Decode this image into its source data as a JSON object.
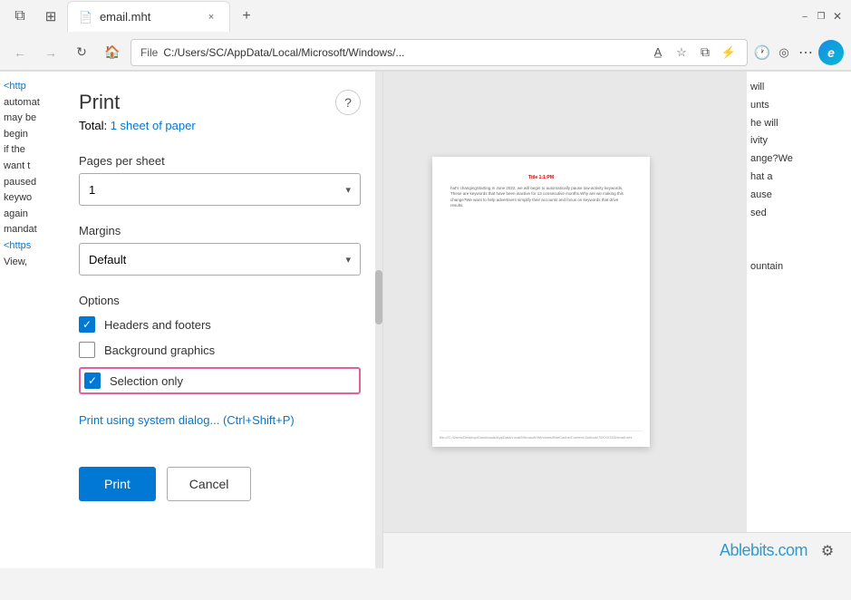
{
  "browser": {
    "title_bar": {
      "tab_label": "email.mht",
      "close_label": "×",
      "new_tab_label": "+",
      "minimize_label": "–",
      "restore_label": "❐",
      "close_win_label": "✕"
    },
    "address_bar": {
      "protocol_label": "File",
      "url": "C:/Users/SC/AppData/Local/Microsoft/Windows/...",
      "back_icon": "←",
      "forward_icon": "→",
      "refresh_icon": "↻",
      "home_icon": "⌂",
      "read_icon": "A̲",
      "bookmark_icon": "☆",
      "collections_icon": "⧉",
      "favorites_icon": "★",
      "history_icon": "🕐",
      "copilot_icon": "◎",
      "more_icon": "⋯"
    }
  },
  "print_dialog": {
    "title": "Print",
    "subtitle_prefix": "Total:",
    "sheet_count": "1 sheet of paper",
    "help_label": "?",
    "pages_per_sheet_label": "Pages per sheet",
    "pages_per_sheet_value": "1",
    "margins_label": "Margins",
    "margins_value": "Default",
    "options_label": "Options",
    "headers_footers_label": "Headers and footers",
    "headers_footers_checked": true,
    "background_graphics_label": "Background graphics",
    "background_graphics_checked": false,
    "selection_only_label": "Selection only",
    "selection_only_checked": true,
    "system_dialog_label": "Print using system dialog... (Ctrl+Shift+P)",
    "print_button_label": "Print",
    "cancel_button_label": "Cancel"
  },
  "background": {
    "left_code": [
      "<http",
      "automat",
      "may be",
      "begin",
      "if the",
      "want t",
      "paused",
      "keywo",
      "again",
      "mandat",
      "<https",
      "View,"
    ],
    "right_code": [
      "will",
      "unts",
      "he will",
      "ivity",
      "ange?We",
      "hat a",
      "ause",
      "sed",
      "",
      "",
      "ountain"
    ],
    "ablebits_logo": "Ablebits.com"
  },
  "preview": {
    "title": "Title 1:1:PM",
    "body_text": "hat's changingStarting in June 2022, we will begin to automatically pause low-activity keywords. These are keywords that have been inactive for 13 consecutive months.Why are we making this change?We want to help advertisers simplify their accounts and focus on keywords that drive results.",
    "footer_text": "file:///C:/Users/Desktop/Downloads/AppData/Local/Microsoft/Windows/INetCache/Content.Outlook/76XXX333/email.mht"
  }
}
